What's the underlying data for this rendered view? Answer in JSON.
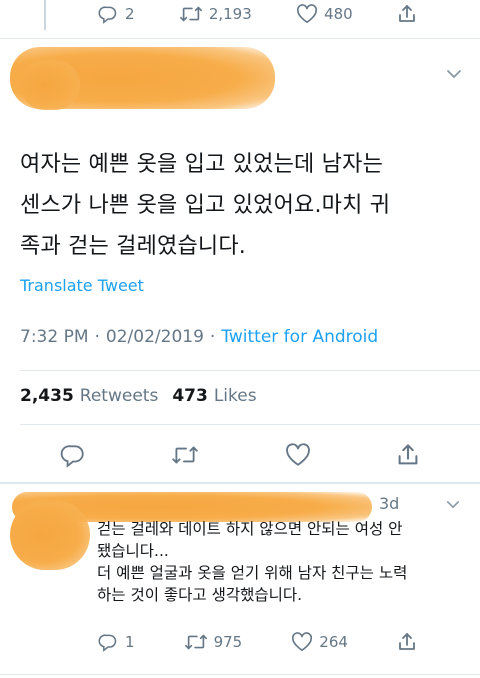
{
  "top_actions": {
    "reply_count": "2",
    "retweet_count": "2,193",
    "like_count": "480"
  },
  "main_tweet": {
    "text_lines": [
      "여자는 예쁜 옷을 입고 있었는데 남자는",
      "센스가 나쁜 옷을 입고 있었어요.마치 귀",
      "족과 걷는 걸레였습니다."
    ],
    "translate_label": "Translate Tweet",
    "time": "7:32 PM",
    "dot": "·",
    "date": "02/02/2019",
    "source": "Twitter for Android"
  },
  "stats": {
    "retweets_value": "2,435",
    "retweets_label": "Retweets",
    "likes_value": "473",
    "likes_label": "Likes"
  },
  "reply": {
    "time_ago": "3d",
    "text_lines": [
      "걷는 걸레와 데이트 하지 않으면 안되는 여성 안",
      "됐습니다...",
      "더 예쁜 얼굴과 옷을 얻기 위해 남자 친구는 노력",
      "하는 것이 좋다고 생각했습니다."
    ],
    "reply_count": "1",
    "retweet_count": "975",
    "like_count": "264"
  },
  "colors": {
    "link": "#1da1f2",
    "muted": "#657786",
    "redaction": "#f6a640"
  },
  "icons": [
    "reply-icon",
    "retweet-icon",
    "like-icon",
    "share-icon",
    "chevron-down-icon"
  ]
}
